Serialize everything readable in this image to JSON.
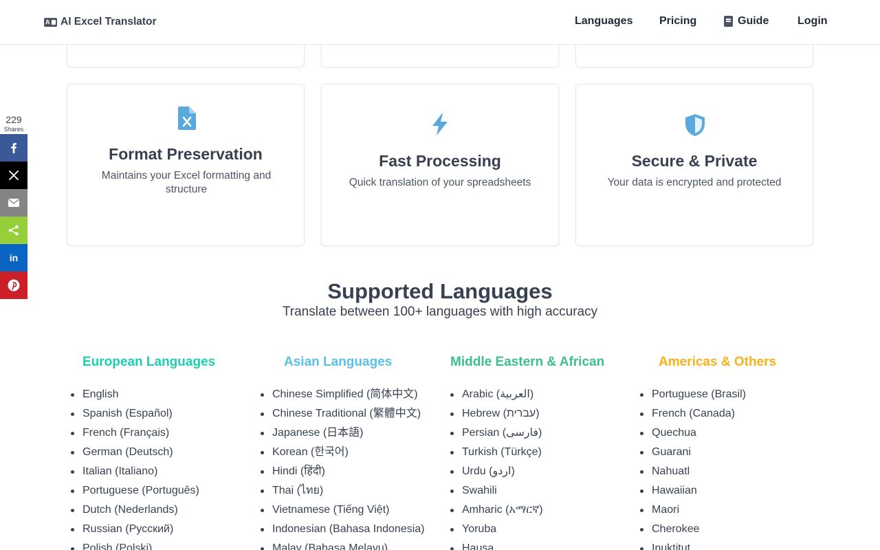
{
  "header": {
    "brand": "AI Excel Translator",
    "nav": [
      {
        "label": "Languages"
      },
      {
        "label": "Pricing"
      },
      {
        "label": "Guide"
      },
      {
        "label": "Login"
      }
    ]
  },
  "features": [
    {
      "title": "Format Preservation",
      "desc": "Maintains your Excel formatting and structure",
      "icon": "excel-file-icon"
    },
    {
      "title": "Fast Processing",
      "desc": "Quick translation of your spreadsheets",
      "icon": "lightning-icon"
    },
    {
      "title": "Secure & Private",
      "desc": "Your data is encrypted and protected",
      "icon": "shield-icon"
    }
  ],
  "share": {
    "count": "229",
    "label": "Shares",
    "buttons": [
      {
        "name": "facebook",
        "color": "#3b5998"
      },
      {
        "name": "x",
        "color": "#000000"
      },
      {
        "name": "email",
        "color": "#848484"
      },
      {
        "name": "share",
        "color": "#95d03a"
      },
      {
        "name": "linkedin",
        "color": "#0a66c2"
      },
      {
        "name": "pinterest",
        "color": "#cb2027"
      }
    ]
  },
  "languages": {
    "title": "Supported Languages",
    "subtitle": "Translate between 100+ languages with high accuracy",
    "columns": [
      {
        "title": "European Languages",
        "color": "#1ccfb0",
        "items": [
          "English",
          "Spanish (Español)",
          "French (Français)",
          "German (Deutsch)",
          "Italian (Italiano)",
          "Portuguese (Português)",
          "Dutch (Nederlands)",
          "Russian (Русский)",
          "Polish (Polski)"
        ]
      },
      {
        "title": "Asian Languages",
        "color": "#5ebfe6",
        "items": [
          "Chinese Simplified (简体中文)",
          "Chinese Traditional (繁體中文)",
          "Japanese (日本語)",
          "Korean (한국어)",
          "Hindi (हिंदी)",
          "Thai (ไทย)",
          "Vietnamese (Tiếng Việt)",
          "Indonesian (Bahasa Indonesia)",
          "Malay (Bahasa Melayu)"
        ]
      },
      {
        "title": "Middle Eastern & African",
        "color": "#3cbf8a",
        "items": [
          "Arabic (العربية)",
          "Hebrew (עברית)",
          "Persian (فارسی)",
          "Turkish (Türkçe)",
          "Urdu (اردو)",
          "Swahili",
          "Amharic (አማርኛ)",
          "Yoruba",
          "Hausa"
        ]
      },
      {
        "title": "Americas & Others",
        "color": "#f5b21b",
        "items": [
          "Portuguese (Brasil)",
          "French (Canada)",
          "Quechua",
          "Guarani",
          "Nahuatl",
          "Hawaiian",
          "Maori",
          "Cherokee",
          "Inuktitut"
        ]
      }
    ]
  }
}
